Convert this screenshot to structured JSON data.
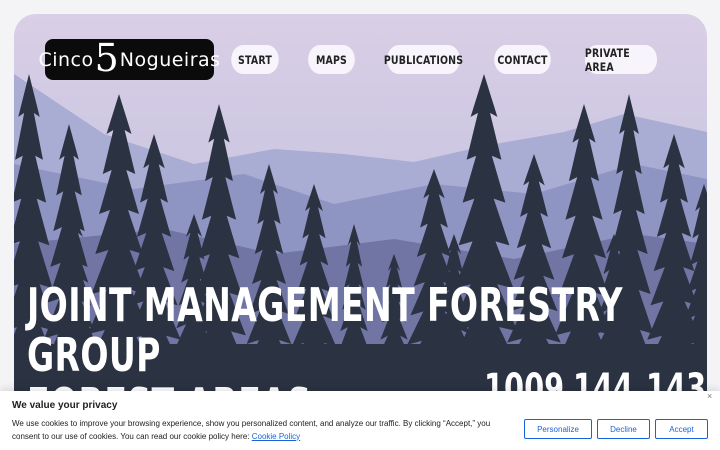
{
  "logo": {
    "before": "Cinco",
    "number": "5",
    "after": "Nogueiras"
  },
  "nav": {
    "items": [
      "START",
      "MAPS",
      "PUBLICATIONS",
      "CONTACT",
      "PRIVATE AREA"
    ]
  },
  "hero": {
    "line1": "JOINT MANAGEMENT FORESTRY",
    "line2": "GROUP",
    "line3": "FOREST AREAS"
  },
  "stats": [
    "1009",
    "144",
    "143"
  ],
  "cookie": {
    "title": "We value your privacy",
    "text": "We use cookies to improve your browsing experience, show you personalized content, and analyze our traffic. By clicking “Accept,” you consent to our use of cookies. You can read our cookie policy here:",
    "link": "Cookie Policy",
    "close": "×",
    "buttons": {
      "personalize": "Personalize",
      "decline": "Decline",
      "accept": "Accept"
    }
  },
  "colors": {
    "sky": "#d9cfe6",
    "mountain": "#8e95c4",
    "trees": "#2a3140",
    "accent": "#1863dc"
  }
}
